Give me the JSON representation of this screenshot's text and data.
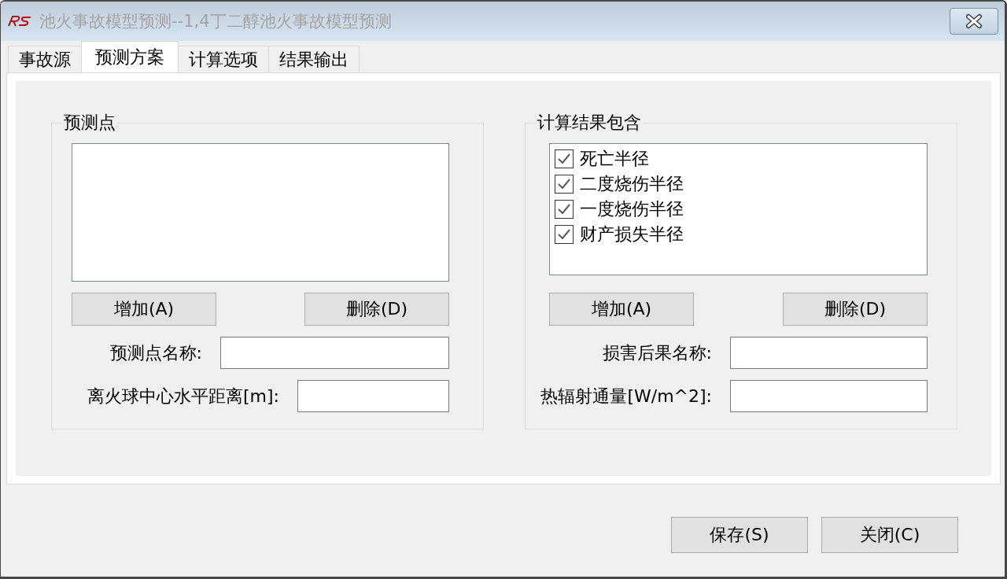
{
  "window": {
    "title": "池火事故模型预测--1,4丁二醇池火事故模型预测"
  },
  "tabs": [
    {
      "label": "事故源",
      "selected": false
    },
    {
      "label": "预测方案",
      "selected": true
    },
    {
      "label": "计算选项",
      "selected": false
    },
    {
      "label": "结果输出",
      "selected": false
    }
  ],
  "prediction_points": {
    "title": "预测点",
    "buttons": [
      "增加(A)",
      "删除(D)"
    ],
    "fields": [
      {
        "label": "预测点名称:"
      },
      {
        "label": "离火球中心水平距离[m]:"
      }
    ]
  },
  "results_included": {
    "title": "计算结果包含",
    "items": [
      {
        "label": "死亡半径",
        "checked": true
      },
      {
        "label": "二度烧伤半径",
        "checked": true
      },
      {
        "label": "一度烧伤半径",
        "checked": true
      },
      {
        "label": "财产损失半径",
        "checked": true
      }
    ],
    "buttons": [
      "增加(A)",
      "删除(D)"
    ],
    "fields": [
      {
        "label": "损害后果名称:"
      },
      {
        "label": "热辐射通量[W/m^2]:"
      }
    ]
  },
  "buttons": [
    "保存(S)",
    "关闭(C)"
  ]
}
